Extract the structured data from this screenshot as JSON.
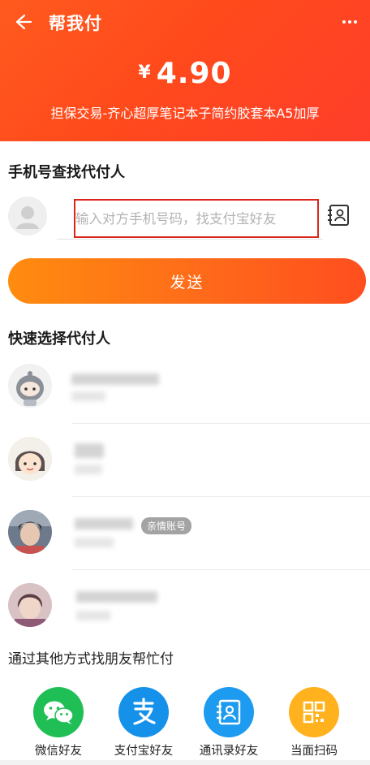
{
  "header": {
    "title": "帮我付",
    "currency": "¥",
    "amount": "4.90",
    "description": "担保交易-齐心超厚笔记本子简约胶套本A5加厚"
  },
  "phone_search": {
    "title": "手机号查找代付人",
    "placeholder": "输入对方手机号码，找支付宝好友"
  },
  "send_button": "发送",
  "quick_select": {
    "title": "快速选择代付人",
    "contacts": [
      {
        "avatar": "robot-avatar"
      },
      {
        "avatar": "cartoon-girl-avatar"
      },
      {
        "avatar": "photo-avatar",
        "badge": "亲情账号"
      },
      {
        "avatar": "photo-avatar"
      }
    ]
  },
  "other_ways": {
    "title": "通过其他方式找朋友帮忙付",
    "items": [
      {
        "label": "微信好友",
        "icon": "wechat-icon",
        "color": "#1fbf56"
      },
      {
        "label": "支付宝好友",
        "icon": "alipay-icon",
        "color": "#1591ea"
      },
      {
        "label": "通讯录好友",
        "icon": "contacts-icon",
        "color": "#1d9bf0"
      },
      {
        "label": "当面扫码",
        "icon": "qrcode-icon",
        "color": "#ffb21e"
      }
    ]
  },
  "colors": {
    "header_orange": "#ff4a1c",
    "send_button": "#ff6a1a",
    "highlight_border": "#d9261c"
  }
}
